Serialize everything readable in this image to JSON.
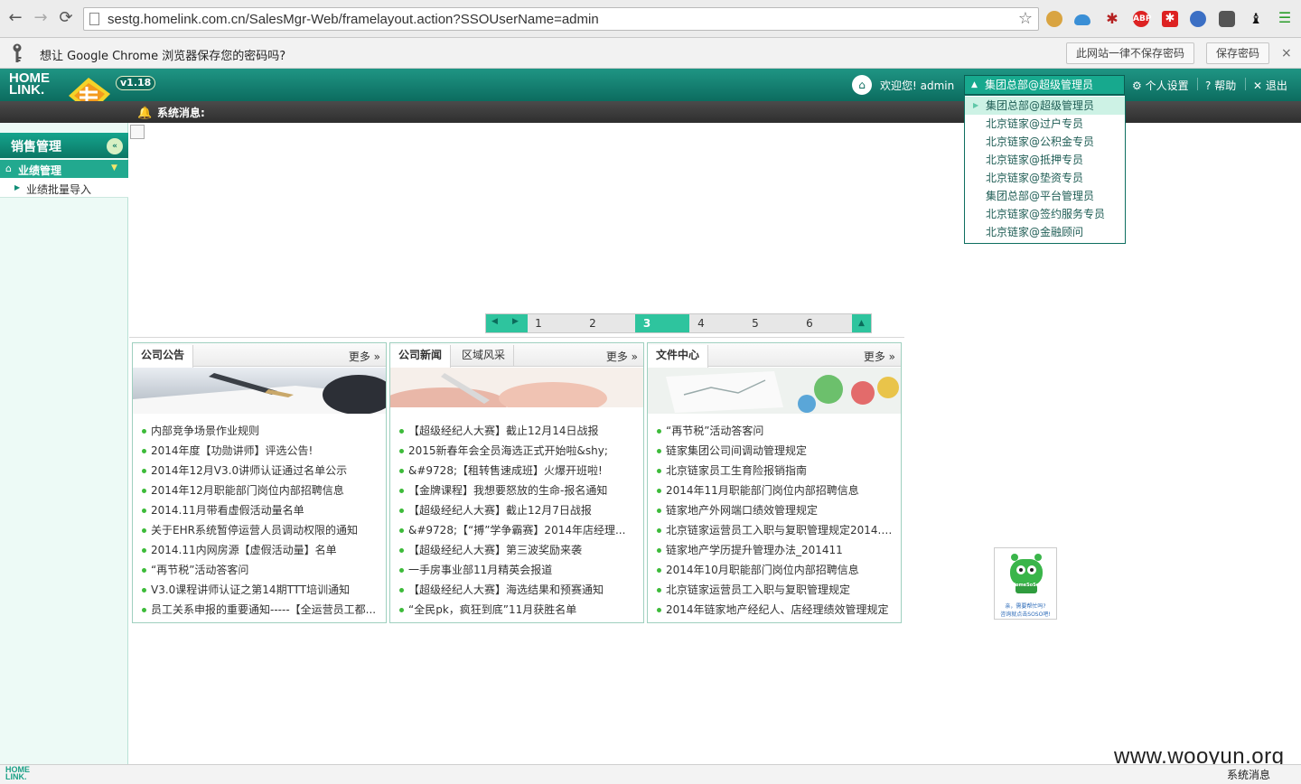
{
  "browser": {
    "url": "sestg.homelink.com.cn/SalesMgr-Web/framelayout.action?SSOUserName=admin",
    "extensions": [
      "cookie-icon",
      "cloud-icon",
      "spider-icon",
      "abp-icon",
      "gift-icon",
      "globe-icon",
      "evernote-icon",
      "chess-icon",
      "menu-icon"
    ],
    "abp_label": "ABP"
  },
  "password_bar": {
    "message": "想让 Google Chrome 浏览器保存您的密码吗?",
    "never_label": "此网站一律不保存密码",
    "save_label": "保存密码",
    "close": "×"
  },
  "header": {
    "logo": "HOME LINK.",
    "version": "v1.18",
    "welcome": "欢迎您! admin",
    "role_selected": "集团总部@超级管理员",
    "settings_label": "个人设置",
    "help_label": "帮助",
    "logout_label": "退出"
  },
  "role_options": [
    "集团总部@超级管理员",
    "北京链家@过户专员",
    "北京链家@公积金专员",
    "北京链家@抵押专员",
    "北京链家@垫资专员",
    "集团总部@平台管理员",
    "北京链家@签约服务专员",
    "北京链家@金融顾问"
  ],
  "notice": {
    "label": "系统消息:"
  },
  "sidebar": {
    "title": "销售管理",
    "section": "业绩管理",
    "items": [
      "业绩批量导入"
    ]
  },
  "pager": {
    "pages": [
      "1",
      "2",
      "3",
      "4",
      "5",
      "6"
    ],
    "active": "3"
  },
  "panels": [
    {
      "tabs": [
        "公司公告"
      ],
      "more": "更多 »",
      "items": [
        "内部竞争场景作业规则",
        "2014年度【功勋讲师】评选公告!",
        "2014年12月V3.0讲师认证通过名单公示",
        "2014年12月职能部门岗位内部招聘信息",
        "2014.11月带看虚假活动量名单",
        "关于EHR系统暂停运营人员调动权限的通知",
        "2014.11内网房源【虚假活动量】名单",
        "“再节税”活动答客问",
        "V3.0课程讲师认证之第14期TTT培训通知",
        "员工关系申报的重要通知-----【全运营员工都..."
      ]
    },
    {
      "tabs": [
        "公司新闻",
        "区域风采"
      ],
      "more": "更多 »",
      "items": [
        "【超级经纪人大赛】截止12月14日战报",
        "2015新春年会全员海选正式开始啦&shy;",
        "&#9728;【租转售速成班】火爆开班啦!",
        "【金牌课程】我想要怒放的生命-报名通知",
        "【超级经纪人大赛】截止12月7日战报",
        "&#9728;【“搏”学争霸赛】2014年店经理...",
        "【超级经纪人大赛】第三波奖励来袭",
        "一手房事业部11月精英会报道",
        "【超级经纪人大赛】海选结果和预赛通知",
        "“全民pk，疯狂到底”11月获胜名单"
      ]
    },
    {
      "tabs": [
        "文件中心"
      ],
      "more": "更多 »",
      "items": [
        "“再节税”活动答客问",
        "链家集团公司间调动管理规定",
        "北京链家员工生育险报销指南",
        "2014年11月职能部门岗位内部招聘信息",
        "链家地产外网端口绩效管理规定",
        "北京链家运营员工入职与复职管理规定2014.1...",
        "链家地产学历提升管理办法_201411",
        "2014年10月职能部门岗位内部招聘信息",
        "北京链家运营员工入职与复职管理规定",
        "2014年链家地产经纪人、店经理绩效管理规定"
      ]
    }
  ],
  "mascot": {
    "line1": "HomeSoSo",
    "line2": "亲，需要帮忙吗?",
    "line3": "咨询就点击SOSO吧!"
  },
  "watermark": "www.wooyun.org",
  "status": {
    "logo": "HOME LINK.",
    "text": "系统消息"
  },
  "colors": {
    "brand": "#0e7566",
    "accent": "#2ec49e",
    "bullet": "#3dbb3a"
  }
}
